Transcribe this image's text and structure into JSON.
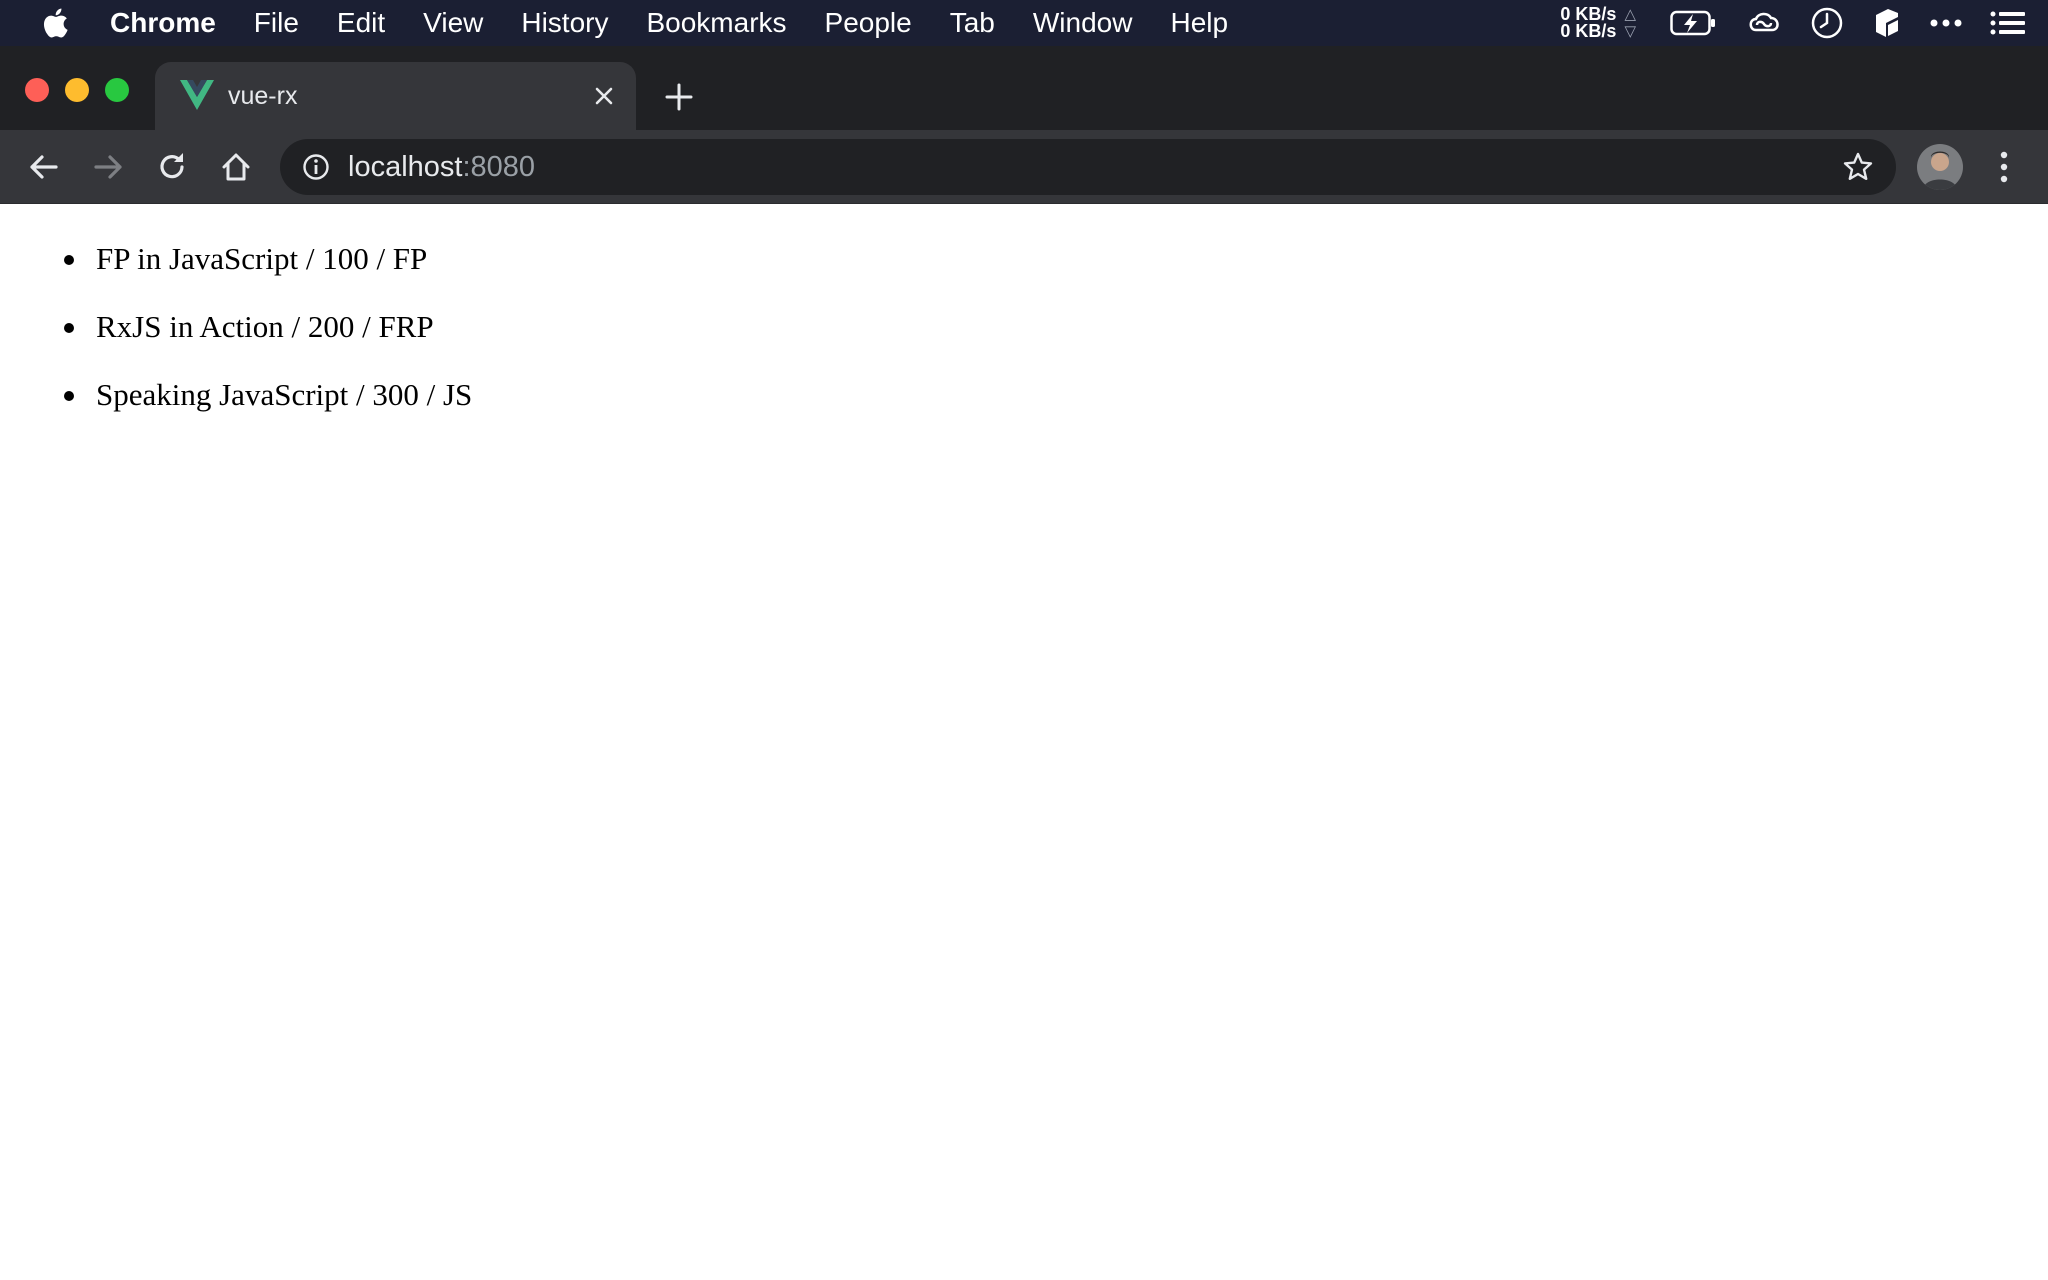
{
  "menubar": {
    "app_name": "Chrome",
    "items": [
      "File",
      "Edit",
      "View",
      "History",
      "Bookmarks",
      "People",
      "Tab",
      "Window",
      "Help"
    ],
    "netspeed": {
      "up": "0 KB/s",
      "down": "0 KB/s",
      "up_arrow": "△",
      "down_arrow": "▽"
    },
    "icons": [
      "apple-icon",
      "battery-charging-icon",
      "creative-cloud-icon",
      "clock-icon",
      "notion-icon",
      "more-dots-icon",
      "list-icon"
    ]
  },
  "browser": {
    "tab": {
      "title": "vue-rx",
      "favicon": "vue-logo-icon"
    },
    "url": {
      "host": "localhost",
      "port": ":8080"
    }
  },
  "page": {
    "books": [
      {
        "text": "FP in JavaScript / 100 / FP"
      },
      {
        "text": "RxJS in Action / 200 / FRP"
      },
      {
        "text": "Speaking JavaScript / 300 / JS"
      }
    ]
  },
  "colors": {
    "menubar_bg": "#1b1f33",
    "tabstrip_bg": "#202124",
    "toolbar_bg": "#35363a",
    "vue_green": "#41b883",
    "traffic_close": "#fe5f57",
    "traffic_minimize": "#febc2e",
    "traffic_maximize": "#28c840"
  }
}
